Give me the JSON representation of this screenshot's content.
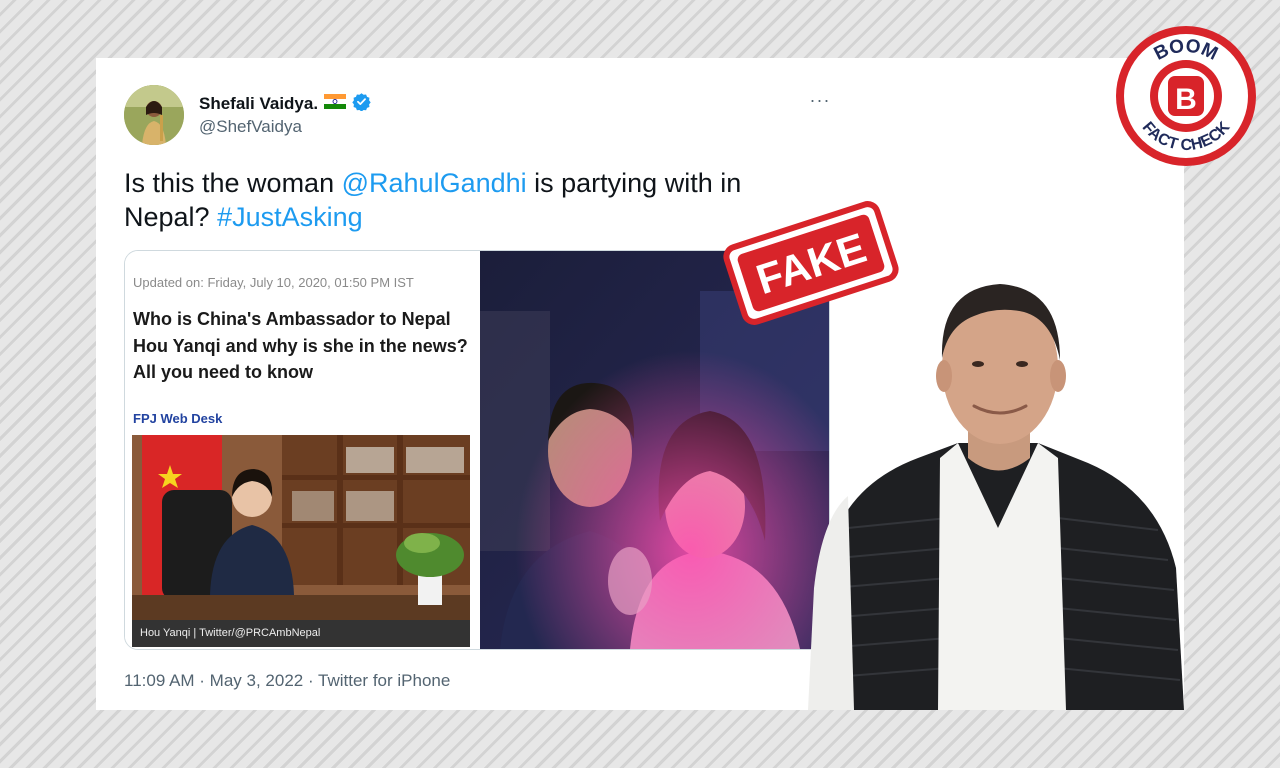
{
  "tweet": {
    "display_name": "Shefali Vaidya.",
    "flag_icon": "india-flag-icon",
    "verified_icon": "verified-badge-icon",
    "handle": "@ShefVaidya",
    "text_part1": "Is this the woman ",
    "mention": "@RahulGandhi",
    "text_part2": " is partying with in Nepal? ",
    "hashtag": "#JustAsking",
    "timestamp": "11:09 AM · May 3, 2022 · Twitter for iPhone",
    "more_label": "···"
  },
  "article": {
    "updated": "Updated on: Friday, July 10, 2020, 01:50 PM IST",
    "headline": "Who is China's Ambassador to Nepal Hou Yanqi and why is she in the news? All you need to know",
    "byline": "FPJ Web Desk",
    "caption": "Hou Yanqi | Twitter/@PRCAmbNepal"
  },
  "stamp": {
    "label": "FAKE"
  },
  "badge": {
    "top_text": "BOOM",
    "bottom_text": "FACT CHECK",
    "letter": "B"
  },
  "colors": {
    "link": "#1d9bf0",
    "stamp_red": "#d8242a",
    "badge_red": "#d8242a",
    "byline_blue": "#2243a0"
  }
}
